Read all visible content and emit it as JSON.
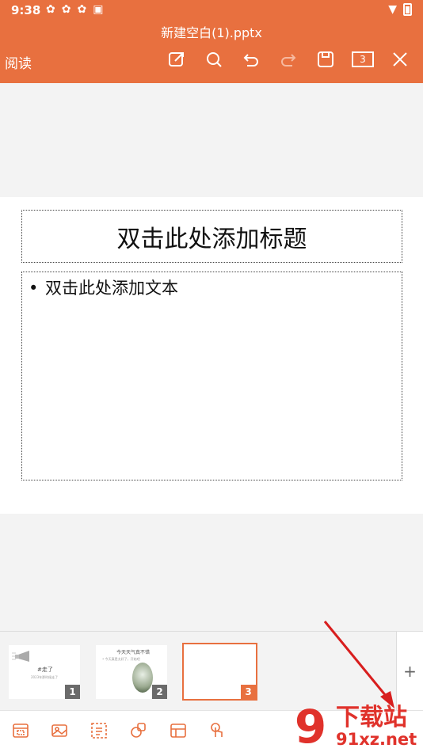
{
  "status_bar": {
    "time": "9:38",
    "icons": [
      "app-icon",
      "app-icon",
      "app-icon",
      "text-icon"
    ],
    "right_icons": [
      "wifi-icon",
      "battery-icon"
    ]
  },
  "header": {
    "file_name": "新建空白(1).pptx",
    "read_label": "阅读",
    "page_count": "3",
    "accent_color": "#e8703f"
  },
  "slide": {
    "title_placeholder": "双击此处添加标题",
    "body_bullet": "•",
    "body_placeholder": "双击此处添加文本"
  },
  "thumbnails": [
    {
      "number": "1",
      "title": "#走了",
      "caption": "2023年那时候走了"
    },
    {
      "number": "2",
      "title": "今天天气真不错",
      "caption": "• 今天真是太好了，开始吧"
    },
    {
      "number": "3",
      "title": "",
      "caption": ""
    }
  ],
  "thumb_strip": {
    "add_label": "+"
  },
  "watermark": {
    "logo": "9",
    "title": "下载站",
    "url": "91xz.net"
  }
}
